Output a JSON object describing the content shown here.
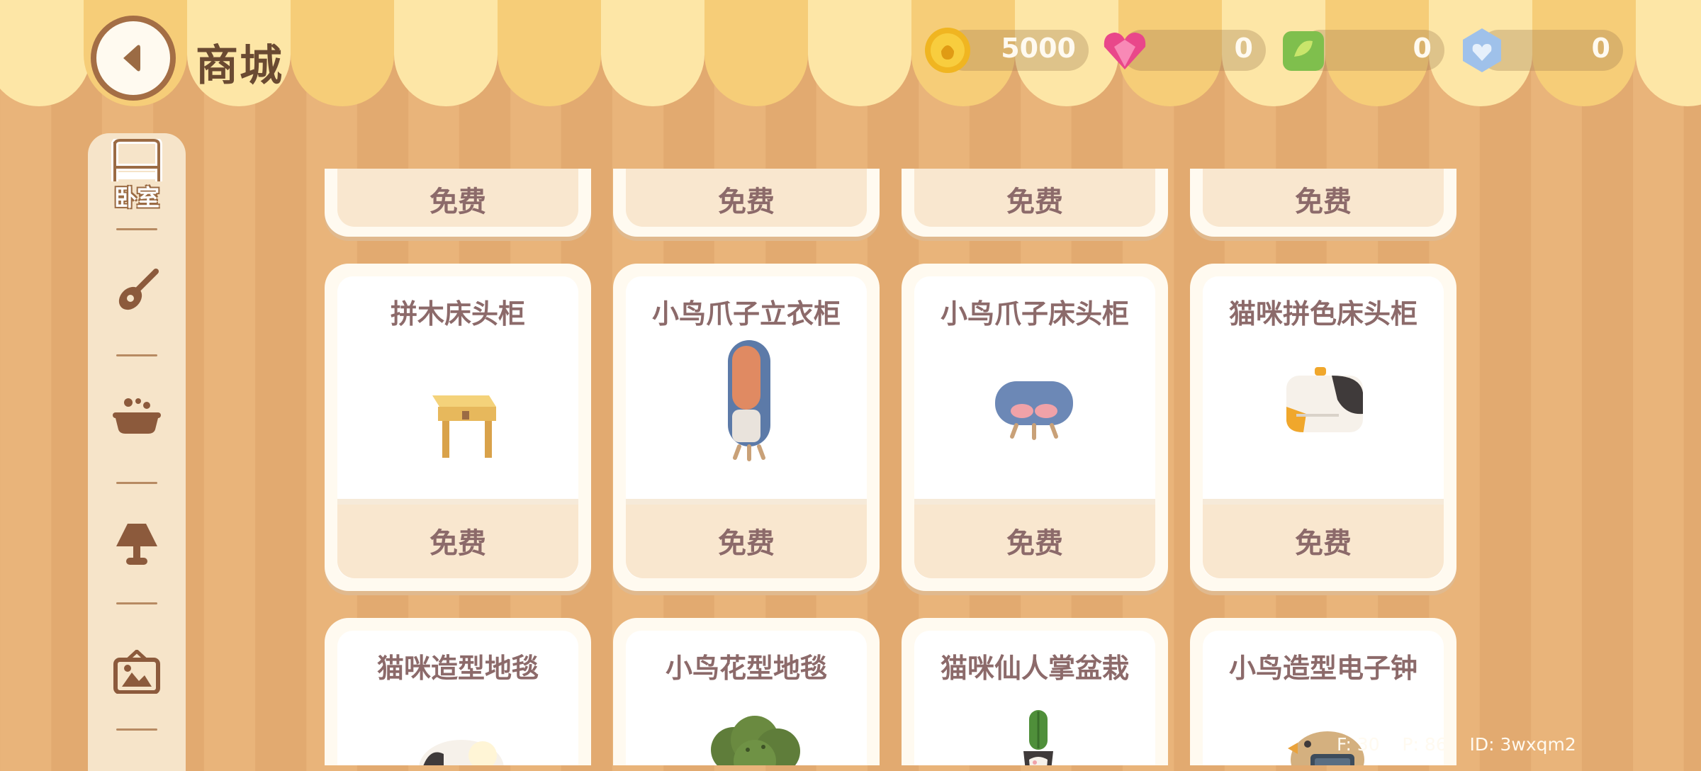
{
  "header": {
    "title": "商城",
    "currencies": [
      {
        "icon": "gold-coin-icon",
        "value": "5000"
      },
      {
        "icon": "pink-heart-gem-icon",
        "value": "0"
      },
      {
        "icon": "green-leaf-ticket-icon",
        "value": "0"
      },
      {
        "icon": "blue-crystal-icon",
        "value": "0"
      }
    ]
  },
  "sidebar": {
    "items": [
      {
        "icon": "bed-icon",
        "label": "卧室",
        "active": true
      },
      {
        "icon": "guitar-icon",
        "label": ""
      },
      {
        "icon": "bathtub-icon",
        "label": ""
      },
      {
        "icon": "lamp-icon",
        "label": ""
      },
      {
        "icon": "picture-frame-icon",
        "label": ""
      }
    ]
  },
  "shop": {
    "row0": [
      {
        "price": "免费"
      },
      {
        "price": "免费"
      },
      {
        "price": "免费"
      },
      {
        "price": "免费"
      }
    ],
    "row1": [
      {
        "name": "拼木床头柜",
        "price": "免费",
        "icon": "wooden-stool-nightstand-icon"
      },
      {
        "name": "小鸟爪子立衣柜",
        "price": "免费",
        "icon": "bird-claw-wardrobe-icon"
      },
      {
        "name": "小鸟爪子床头柜",
        "price": "免费",
        "icon": "bird-claw-nightstand-icon"
      },
      {
        "name": "猫咪拼色床头柜",
        "price": "免费",
        "icon": "cat-color-nightstand-icon"
      }
    ],
    "row2": [
      {
        "name": "猫咪造型地毯",
        "icon": "cat-rug-icon"
      },
      {
        "name": "小鸟花型地毯",
        "icon": "flower-rug-icon"
      },
      {
        "name": "猫咪仙人掌盆栽",
        "icon": "cactus-pot-icon"
      },
      {
        "name": "小鸟造型电子钟",
        "icon": "bird-clock-icon"
      }
    ]
  },
  "debug": {
    "f": "F: 30",
    "p": "P: 86",
    "id": "ID: 3wxqm2"
  },
  "colors": {
    "accent": "#a46e45",
    "text": "#8c6a6a",
    "bg": "#e9b47a"
  }
}
